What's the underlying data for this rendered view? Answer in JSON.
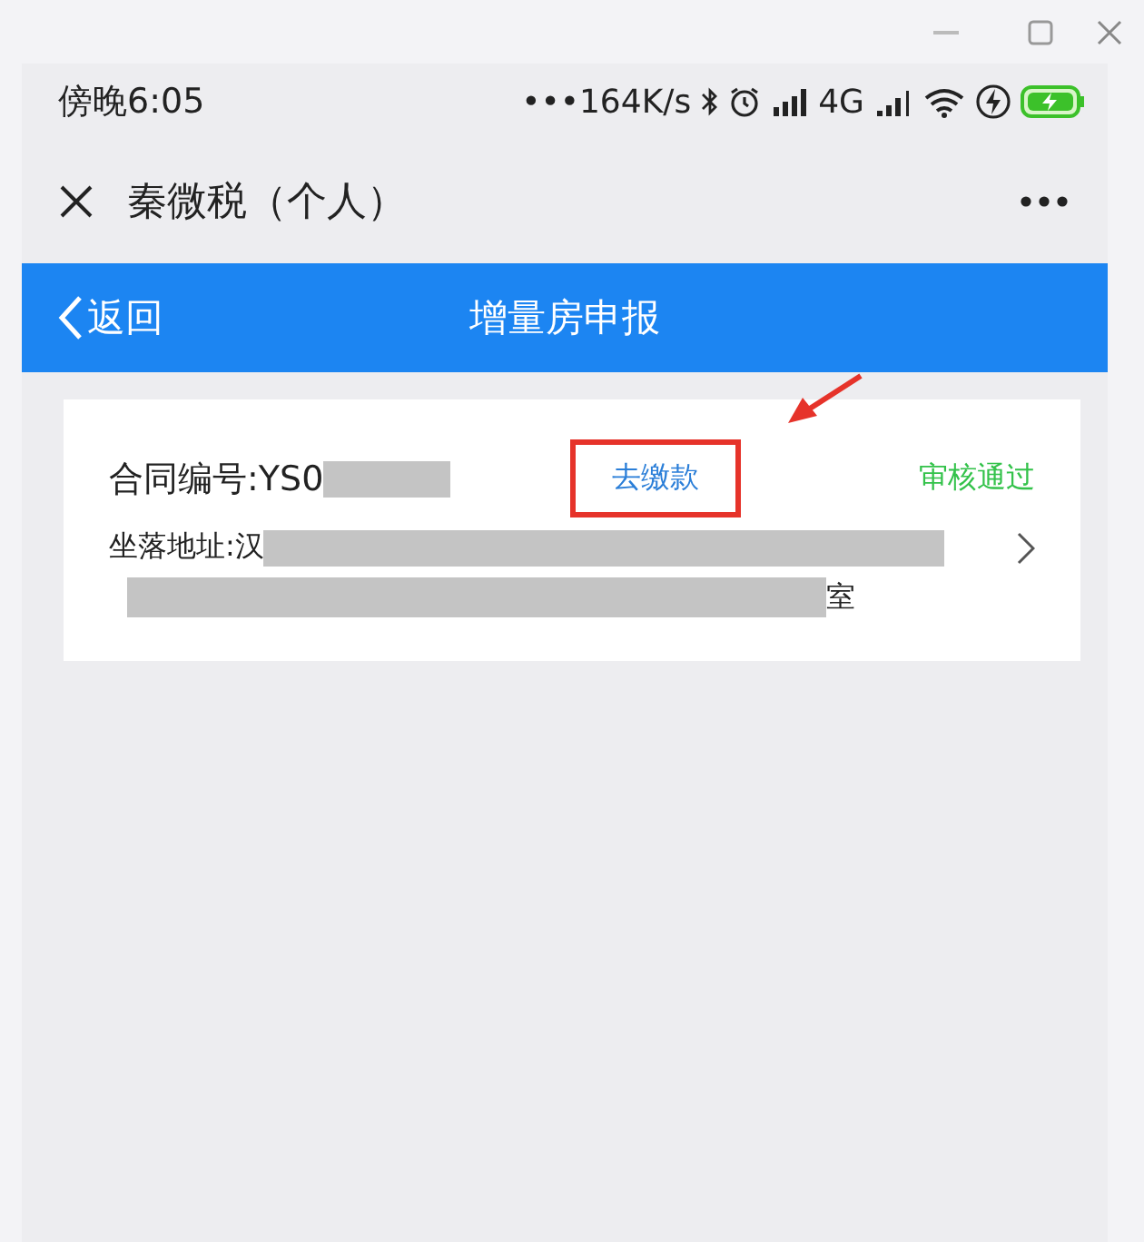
{
  "status_bar": {
    "time": "傍晚6:05",
    "speed": "•••164K/s",
    "network": "4G"
  },
  "app_header": {
    "title": "秦微税（个人）"
  },
  "nav_bar": {
    "back": "返回",
    "title": "增量房申报"
  },
  "record": {
    "contract_label": "合同编号:YS0",
    "action": "去缴款",
    "status": "审核通过",
    "address_start": "坐落地址:汉",
    "address_end": "室",
    "highlighted": true
  }
}
